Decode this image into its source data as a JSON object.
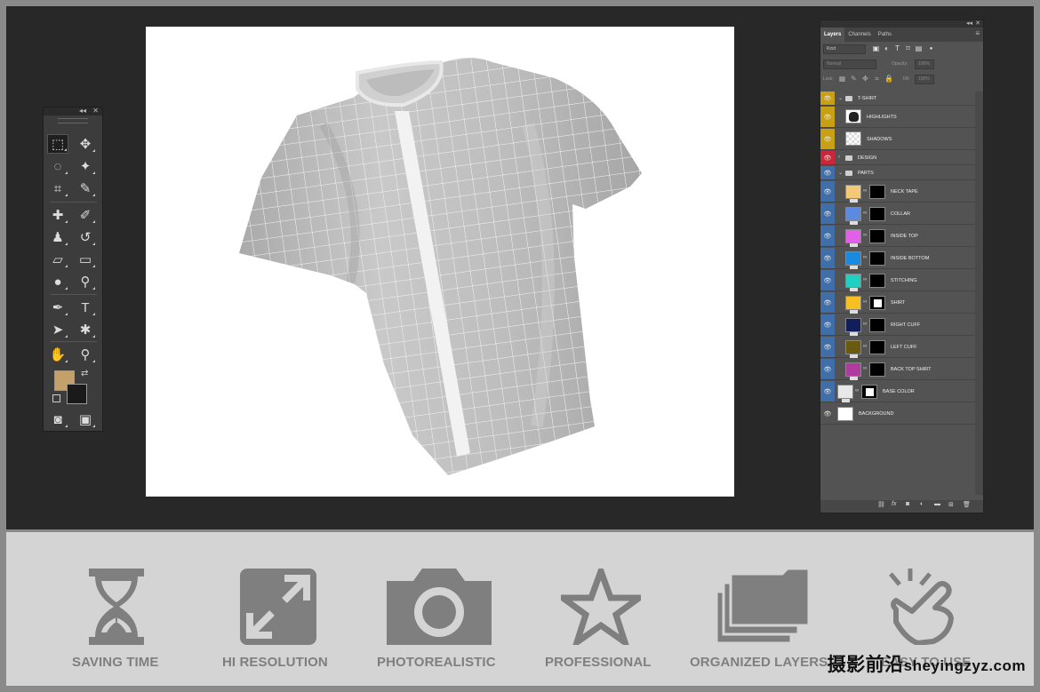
{
  "tools_panel": {
    "collapse_glyph": "◂◂",
    "close_glyph": "✕",
    "tools": [
      [
        "rect-marquee",
        "move"
      ],
      [
        "lasso",
        "magic-wand"
      ],
      [
        "crop",
        "eyedropper"
      ],
      [
        "healing-brush",
        "brush"
      ],
      [
        "clone-stamp",
        "history-brush"
      ],
      [
        "eraser",
        "gradient"
      ],
      [
        "blur",
        "dodge"
      ],
      [
        "pen",
        "type"
      ],
      [
        "path-selection",
        "custom-shape"
      ],
      [
        "hand",
        "zoom"
      ]
    ],
    "foreground_color": "#c4a06a",
    "background_color": "#1a1a1a"
  },
  "layers_panel": {
    "tabs": [
      "Layers",
      "Channels",
      "Paths"
    ],
    "active_tab": "Layers",
    "filter_kind": "Kind",
    "blend_mode": "Normal",
    "opacity_label": "Opacity:",
    "opacity_value": "100%",
    "lock_label": "Lock:",
    "fill_label": "Fill:",
    "fill_value": "100%",
    "layers": [
      {
        "name": "T-SHIRT",
        "type": "group",
        "label_color": "#c8a013"
      },
      {
        "name": "HIGHLIGHTS",
        "type": "layer",
        "label_color": "#c8a013"
      },
      {
        "name": "SHADOWS",
        "type": "layer",
        "label_color": "#c8a013"
      },
      {
        "name": "DESIGN",
        "type": "group",
        "label_color": "#c8283a"
      },
      {
        "name": "PARTS",
        "type": "group",
        "label_color": "#3f6ea8"
      },
      {
        "name": "NECK TAPE",
        "type": "color",
        "swatch": "#f5c878",
        "label_color": "#3f6ea8"
      },
      {
        "name": "COLLAR",
        "type": "color",
        "swatch": "#5b8ae0",
        "label_color": "#3f6ea8"
      },
      {
        "name": "INSIDE TOP",
        "type": "color",
        "swatch": "#e060e8",
        "label_color": "#3f6ea8"
      },
      {
        "name": "INSIDE BOTTOM",
        "type": "color",
        "swatch": "#1a8ae0",
        "label_color": "#3f6ea8"
      },
      {
        "name": "STITCHING",
        "type": "color",
        "swatch": "#20d0c0",
        "label_color": "#3f6ea8"
      },
      {
        "name": "SHIRT",
        "type": "color",
        "swatch": "#f5c020",
        "label_color": "#3f6ea8"
      },
      {
        "name": "RIGHT CUFF",
        "type": "color",
        "swatch": "#101e5a",
        "label_color": "#3f6ea8"
      },
      {
        "name": "LEFT CUFF",
        "type": "color",
        "swatch": "#6a5a10",
        "label_color": "#3f6ea8"
      },
      {
        "name": "BACK TOP SHIRT",
        "type": "color",
        "swatch": "#b03aa0",
        "label_color": "#3f6ea8"
      },
      {
        "name": "BASE COLOR",
        "type": "color",
        "swatch": "#e8e8e8",
        "label_color": "#3f6ea8"
      },
      {
        "name": "BACKGROUND",
        "type": "bg",
        "swatch": "#ffffff",
        "label_color": "#535353"
      }
    ]
  },
  "features": [
    {
      "label": "SAVING TIME",
      "icon": "hourglass-icon"
    },
    {
      "label": "HI RESOLUTION",
      "icon": "expand-icon"
    },
    {
      "label": "PHOTOREALISTIC",
      "icon": "camera-icon"
    },
    {
      "label": "PROFESSIONAL",
      "icon": "star-icon"
    },
    {
      "label": "ORGANIZED LAYERS",
      "icon": "folders-icon"
    },
    {
      "label": "EASY TO USE",
      "icon": "hand-click-icon"
    }
  ],
  "watermark": {
    "text": "摄影前沿",
    "site": "sheyingzyz.com"
  },
  "colors": {
    "icon_gray": "#7f7f7f",
    "workspace": "#282828",
    "strip": "#d4d4d4"
  }
}
